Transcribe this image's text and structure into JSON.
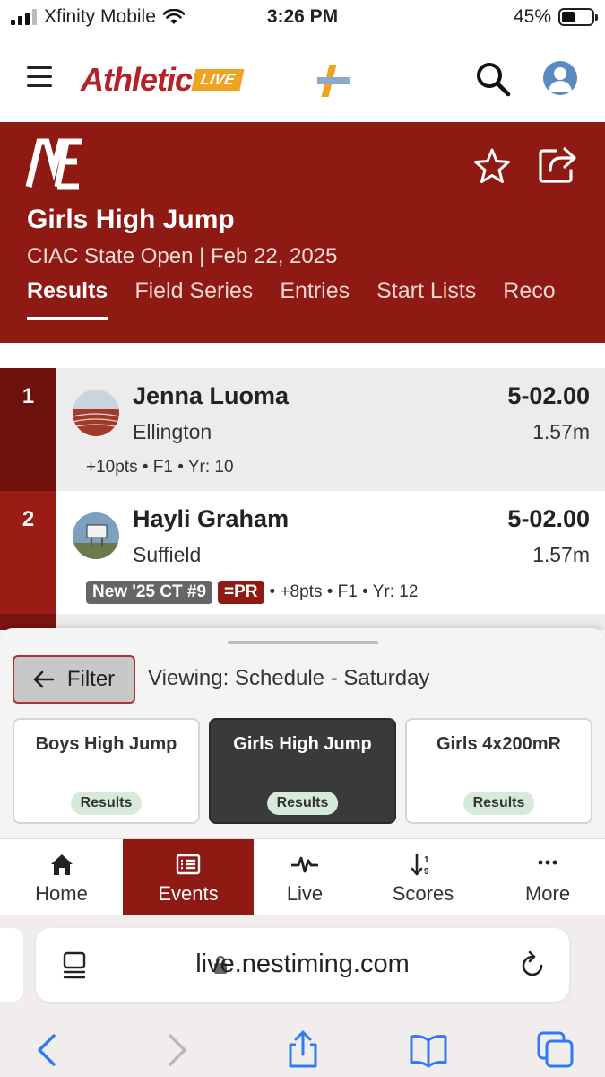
{
  "status_bar": {
    "carrier": "Xfinity Mobile",
    "time": "3:26 PM",
    "battery_text": "45%",
    "battery_level": 0.45
  },
  "app_header": {
    "logo_main": "Athletic",
    "logo_live": "LIVE",
    "icons": [
      "menu-icon",
      "plus-logo-icon",
      "search-icon",
      "account-icon"
    ]
  },
  "event": {
    "logo_text": "NE",
    "title": "Girls High Jump",
    "subtitle": "CIAC State Open | Feb 22, 2025",
    "tabs": [
      {
        "label": "Results",
        "active": true
      },
      {
        "label": "Field Series",
        "active": false
      },
      {
        "label": "Entries",
        "active": false
      },
      {
        "label": "Start Lists",
        "active": false
      },
      {
        "label": "Reco",
        "active": false
      }
    ]
  },
  "results": [
    {
      "place": "1",
      "name": "Jenna Luoma",
      "school": "Ellington",
      "mark": "5-02.00",
      "mark_metric": "1.57m",
      "meta": "+10pts • F1 • Yr: 10",
      "rank_color": "#6e120e"
    },
    {
      "place": "2",
      "name": "Hayli Graham",
      "school": "Suffield",
      "mark": "5-02.00",
      "mark_metric": "1.57m",
      "badge_record": "New '25 CT #9",
      "badge_pr": "=PR",
      "meta": "• +8pts • F1 • Yr: 12",
      "rank_color": "#9a1c15"
    }
  ],
  "filter": {
    "button_label": "Filter",
    "viewing": "Viewing: Schedule - Saturday"
  },
  "event_cards": [
    {
      "title": "Boys High Jump",
      "pill": "Results",
      "active": false
    },
    {
      "title": "Girls High Jump",
      "pill": "Results",
      "active": true
    },
    {
      "title": "Girls 4x200mR",
      "pill": "Results",
      "active": false
    }
  ],
  "bottom_nav": [
    {
      "label": "Home",
      "icon": "home-icon",
      "active": false
    },
    {
      "label": "Events",
      "icon": "list-icon",
      "active": true
    },
    {
      "label": "Live",
      "icon": "pulse-icon",
      "active": false
    },
    {
      "label": "Scores",
      "icon": "sort-icon",
      "active": false
    },
    {
      "label": "More",
      "icon": "more-icon",
      "active": false
    }
  ],
  "browser": {
    "url": "live.nestiming.com"
  },
  "colors": {
    "brand_red": "#8f1a14",
    "accent_orange": "#f0a320",
    "pill_green": "#d5ead9"
  }
}
